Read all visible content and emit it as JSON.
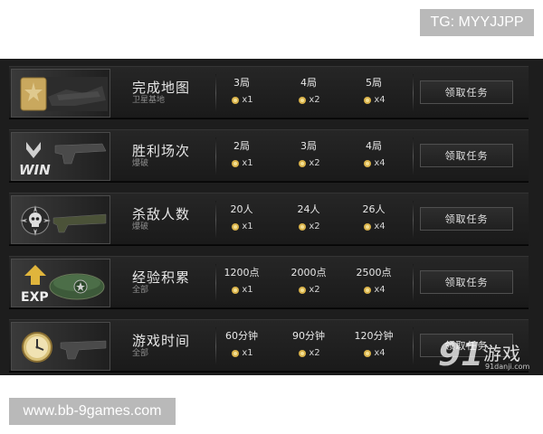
{
  "watermark_top": "TG: MYYJJPP",
  "watermark_bottom": "www.bb-9games.com",
  "site_logo": {
    "number": "91",
    "name": "游戏",
    "url": "91danji.com"
  },
  "colors": {
    "panel_bg": "#1d1d1d",
    "coin": "#d9b24a",
    "button_border": "#4f4f4f"
  },
  "missions": [
    {
      "icon": "map-icon",
      "title": "完成地图",
      "subtitle": "卫星基地",
      "tiers": [
        {
          "req": "3局",
          "reward": "x1"
        },
        {
          "req": "4局",
          "reward": "x2"
        },
        {
          "req": "5局",
          "reward": "x4"
        }
      ],
      "button": "领取任务"
    },
    {
      "icon": "win-icon",
      "title": "胜利场次",
      "subtitle": "爆破",
      "icon_text": "WIN",
      "tiers": [
        {
          "req": "2局",
          "reward": "x1"
        },
        {
          "req": "3局",
          "reward": "x2"
        },
        {
          "req": "4局",
          "reward": "x4"
        }
      ],
      "button": "领取任务"
    },
    {
      "icon": "skull-icon",
      "title": "杀敌人数",
      "subtitle": "爆破",
      "tiers": [
        {
          "req": "20人",
          "reward": "x1"
        },
        {
          "req": "24人",
          "reward": "x2"
        },
        {
          "req": "26人",
          "reward": "x4"
        }
      ],
      "button": "领取任务"
    },
    {
      "icon": "exp-icon",
      "title": "经验积累",
      "subtitle": "全部",
      "icon_text": "EXP",
      "tiers": [
        {
          "req": "1200点",
          "reward": "x1"
        },
        {
          "req": "2000点",
          "reward": "x2"
        },
        {
          "req": "2500点",
          "reward": "x4"
        }
      ],
      "button": "领取任务"
    },
    {
      "icon": "clock-icon",
      "title": "游戏时间",
      "subtitle": "全部",
      "tiers": [
        {
          "req": "60分钟",
          "reward": "x1"
        },
        {
          "req": "90分钟",
          "reward": "x2"
        },
        {
          "req": "120分钟",
          "reward": "x4"
        }
      ],
      "button": "领取任务"
    }
  ]
}
